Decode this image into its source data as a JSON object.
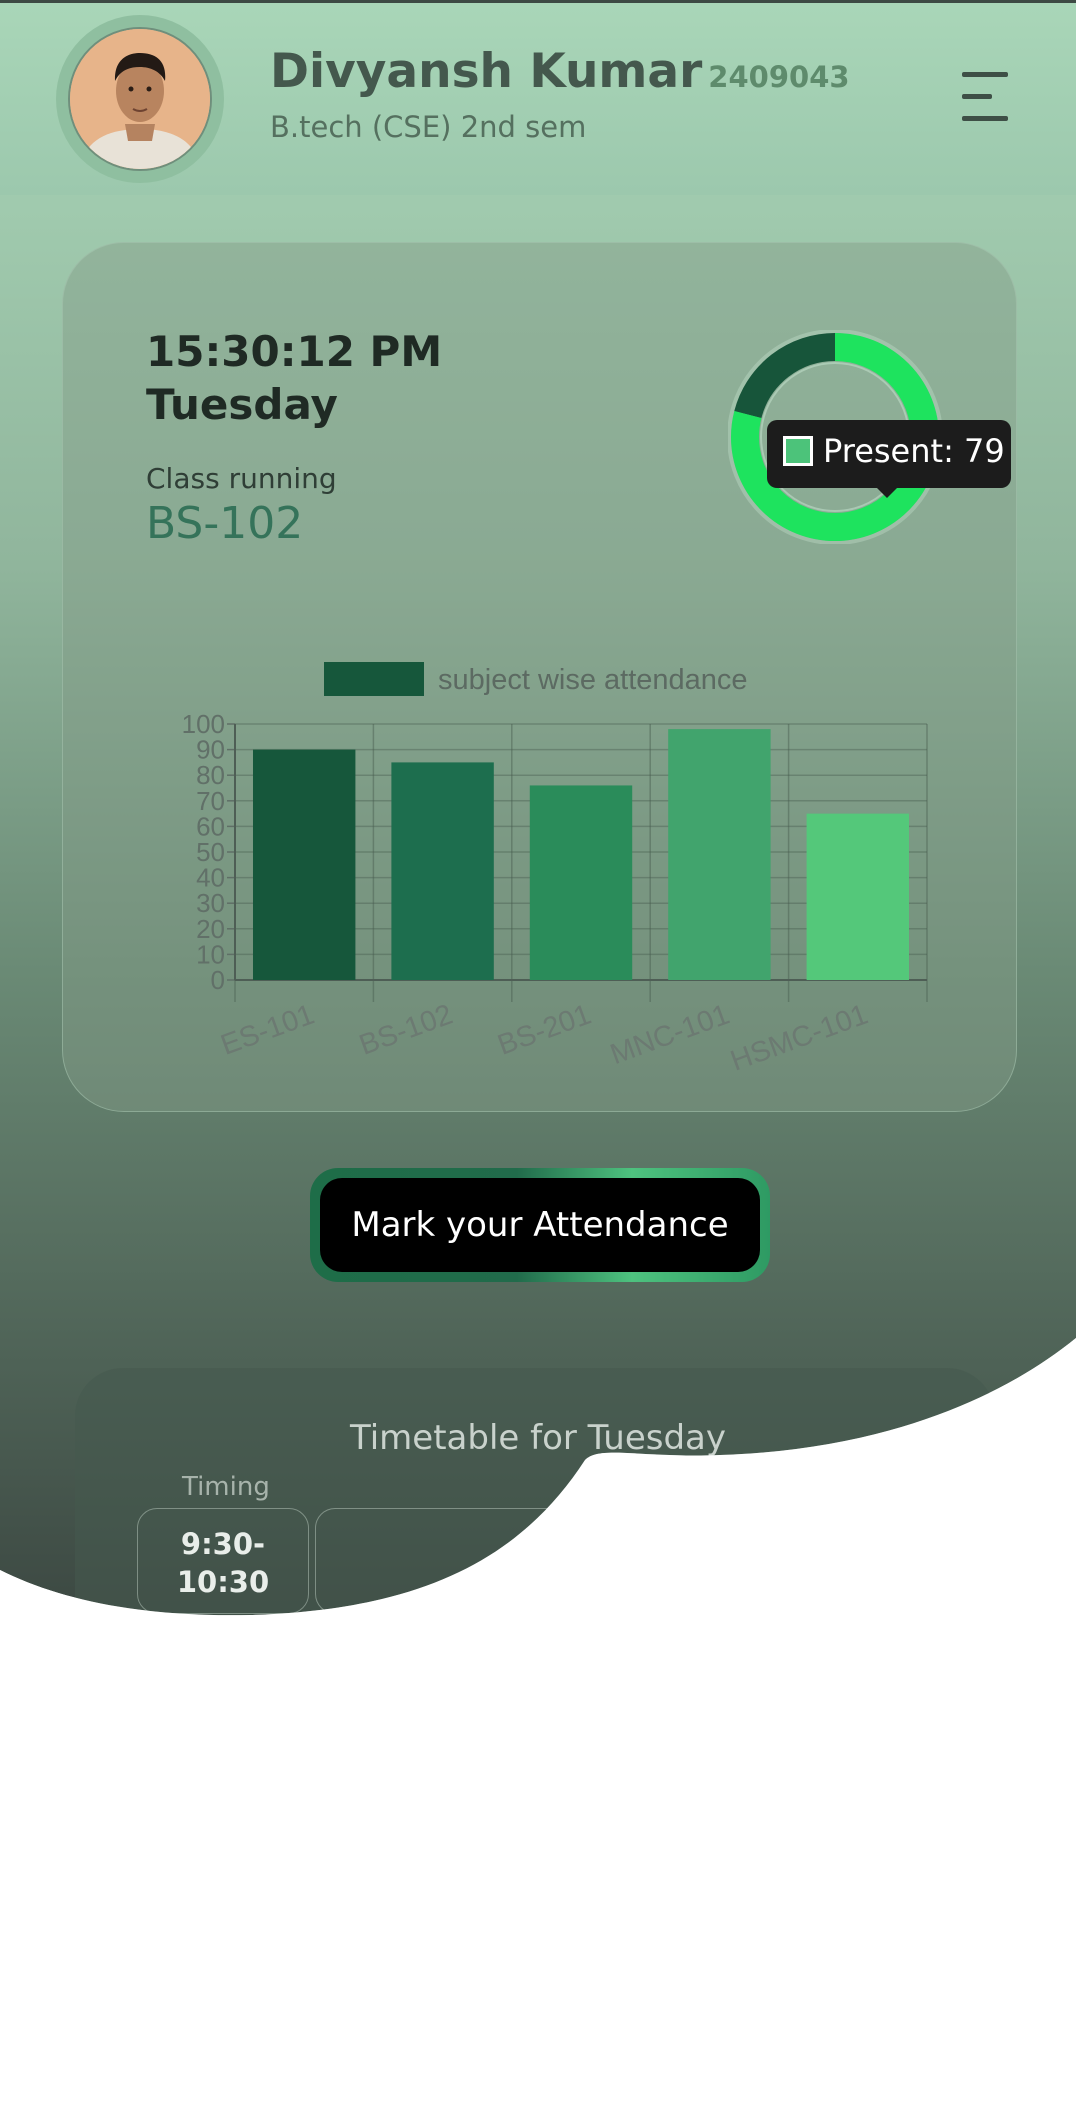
{
  "header": {
    "name": "Divyansh Kumar",
    "roll_no": "2409043",
    "course": "B.tech (CSE) 2nd sem",
    "menu_icon": "hamburger-menu-icon"
  },
  "status": {
    "time": "15:30:12 PM",
    "day": "Tuesday",
    "class_running_label": "Class running",
    "class_running_value": "BS-102"
  },
  "donut": {
    "present": 79,
    "absent": 21,
    "colors": {
      "present": "#1ee35e",
      "absent": "#17553a"
    },
    "tooltip": "Present: 79"
  },
  "chart_data": {
    "type": "bar",
    "categories": [
      "ES-101",
      "BS-102",
      "BS-201",
      "MNC-101",
      "HSMC-101"
    ],
    "series": [
      {
        "name": "subject wise attendance",
        "values": [
          90,
          85,
          76,
          98,
          65
        ]
      }
    ],
    "colors": [
      "#16573b",
      "#1d6e4e",
      "#2a8c5a",
      "#41a46d",
      "#54c87a"
    ],
    "ylim": [
      0,
      100
    ],
    "yticks": [
      "0",
      "10",
      "20",
      "30",
      "40",
      "50",
      "60",
      "70",
      "80",
      "90",
      "100"
    ],
    "legend": "top",
    "grid": true
  },
  "attendance_button": {
    "label": "Mark your Attendance"
  },
  "timetable": {
    "title": "Timetable for Tuesday",
    "timing_label": "Timing",
    "first_slot": "9:30-\n10:30"
  },
  "theme": {
    "accent": "#35735a",
    "bg_top": "#a9d6b8",
    "bg_bottom": "#3f4a44"
  }
}
